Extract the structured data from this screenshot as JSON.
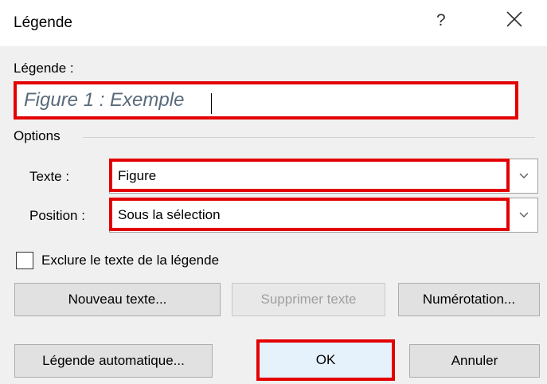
{
  "dialog": {
    "title": "Légende",
    "help_label": "?"
  },
  "caption": {
    "label": "Légende :",
    "value": "Figure 1 : Exemple"
  },
  "options": {
    "group_label": "Options",
    "label_field": {
      "label": "Texte :",
      "value": "Figure"
    },
    "position_field": {
      "label": "Position :",
      "value": "Sous la sélection"
    },
    "exclude_checkbox": {
      "label": "Exclure le texte de la légende",
      "checked": false
    }
  },
  "buttons": {
    "new_label": "Nouveau texte...",
    "delete_label": "Supprimer texte",
    "numbering": "Numérotation...",
    "autocaption": "Légende automatique...",
    "ok": "OK",
    "cancel": "Annuler"
  },
  "colors": {
    "highlight": "#e30000",
    "dialog_bg": "#f0f0f0",
    "button_bg": "#e1e1e1",
    "ok_bg": "#e5f1fb"
  },
  "icons": {
    "close": "close-icon",
    "dropdown": "chevron-down-icon"
  }
}
